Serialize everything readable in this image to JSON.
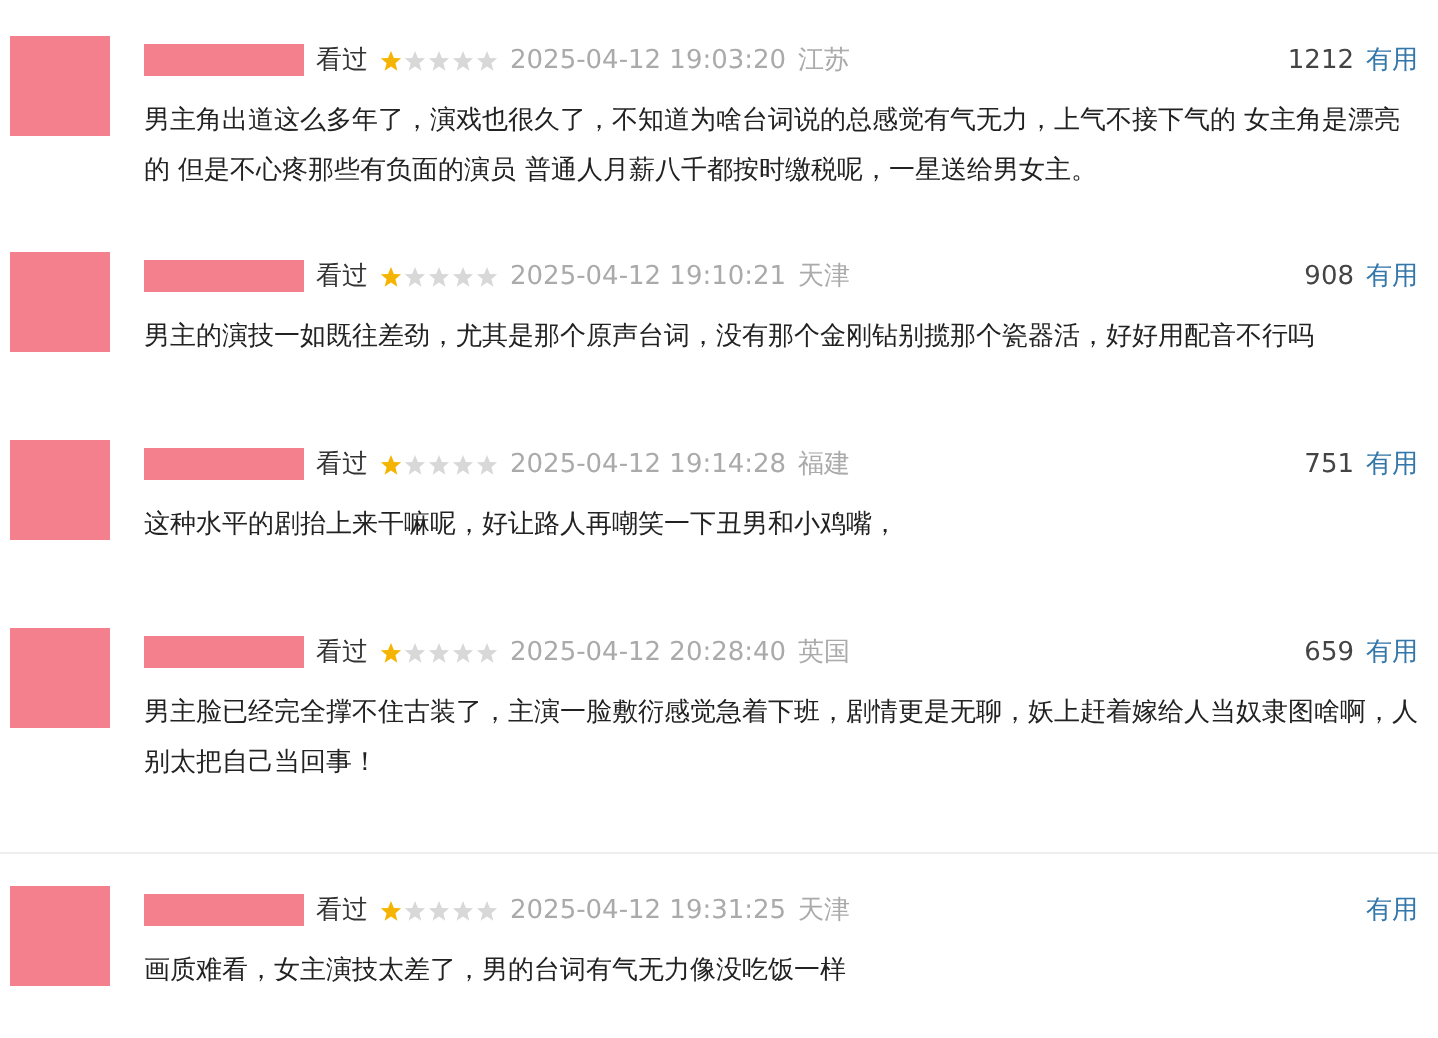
{
  "reviews": [
    {
      "status": "看过",
      "stars": 1,
      "time": "2025-04-12 19:03:20",
      "location": "江苏",
      "votes": "1212",
      "vote_label": "有用",
      "text": "男主角出道这么多年了，演戏也很久了，不知道为啥台词说的总感觉有气无力，上气不接下气的 女主角是漂亮的 但是不心疼那些有负面的演员 普通人月薪八千都按时缴税呢，一星送给男女主。"
    },
    {
      "status": "看过",
      "stars": 1,
      "time": "2025-04-12 19:10:21",
      "location": "天津",
      "votes": "908",
      "vote_label": "有用",
      "text": "男主的演技一如既往差劲，尤其是那个原声台词，没有那个金刚钻别揽那个瓷器活，好好用配音不行吗"
    },
    {
      "status": "看过",
      "stars": 1,
      "time": "2025-04-12 19:14:28",
      "location": "福建",
      "votes": "751",
      "vote_label": "有用",
      "text": "这种水平的剧抬上来干嘛呢，好让路人再嘲笑一下丑男和小鸡嘴，"
    },
    {
      "status": "看过",
      "stars": 1,
      "time": "2025-04-12 20:28:40",
      "location": "英国",
      "votes": "659",
      "vote_label": "有用",
      "text": "男主脸已经完全撑不住古装了，主演一脸敷衍感觉急着下班，剧情更是无聊，妖上赶着嫁给人当奴隶图啥啊，人别太把自己当回事！"
    },
    {
      "status": "看过",
      "stars": 1,
      "time": "2025-04-12 19:31:25",
      "location": "天津",
      "vote_label": "有用",
      "text": "画质难看，女主演技太差了，男的台词有气无力像没吃饭一样"
    }
  ]
}
